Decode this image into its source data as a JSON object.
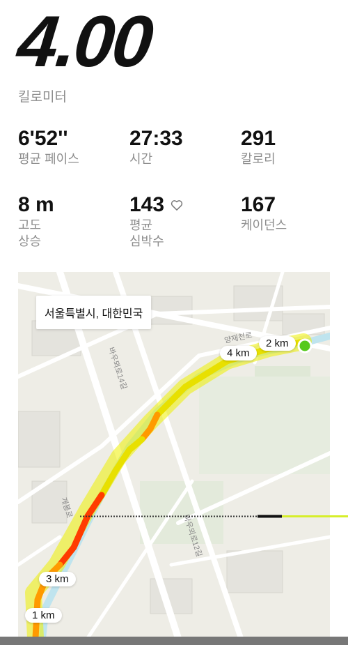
{
  "distance": {
    "value": "4.00",
    "unit": "킬로미터"
  },
  "stats": [
    {
      "value": "6'52''",
      "label": "평균 페이스"
    },
    {
      "value": "27:33",
      "label": "시간"
    },
    {
      "value": "291",
      "label": "칼로리"
    },
    {
      "value": "8 m",
      "label1": "고도",
      "label2": "상승"
    },
    {
      "value": "143",
      "label1": "평균",
      "label2": "심박수",
      "icon": "heart-outline-icon"
    },
    {
      "value": "167",
      "label": "케이던스"
    }
  ],
  "map": {
    "location": "서울특별시, 대한민국",
    "km_markers": [
      "1 km",
      "2 km",
      "3 km",
      "4 km"
    ],
    "road_labels": [
      "양재천로",
      "바우뫼로14길",
      "바우뫼로12길",
      "개봉로"
    ],
    "start_color": "#55c91c",
    "route_colors": [
      "#e8e000",
      "#ff9a00",
      "#ff3c00"
    ]
  }
}
